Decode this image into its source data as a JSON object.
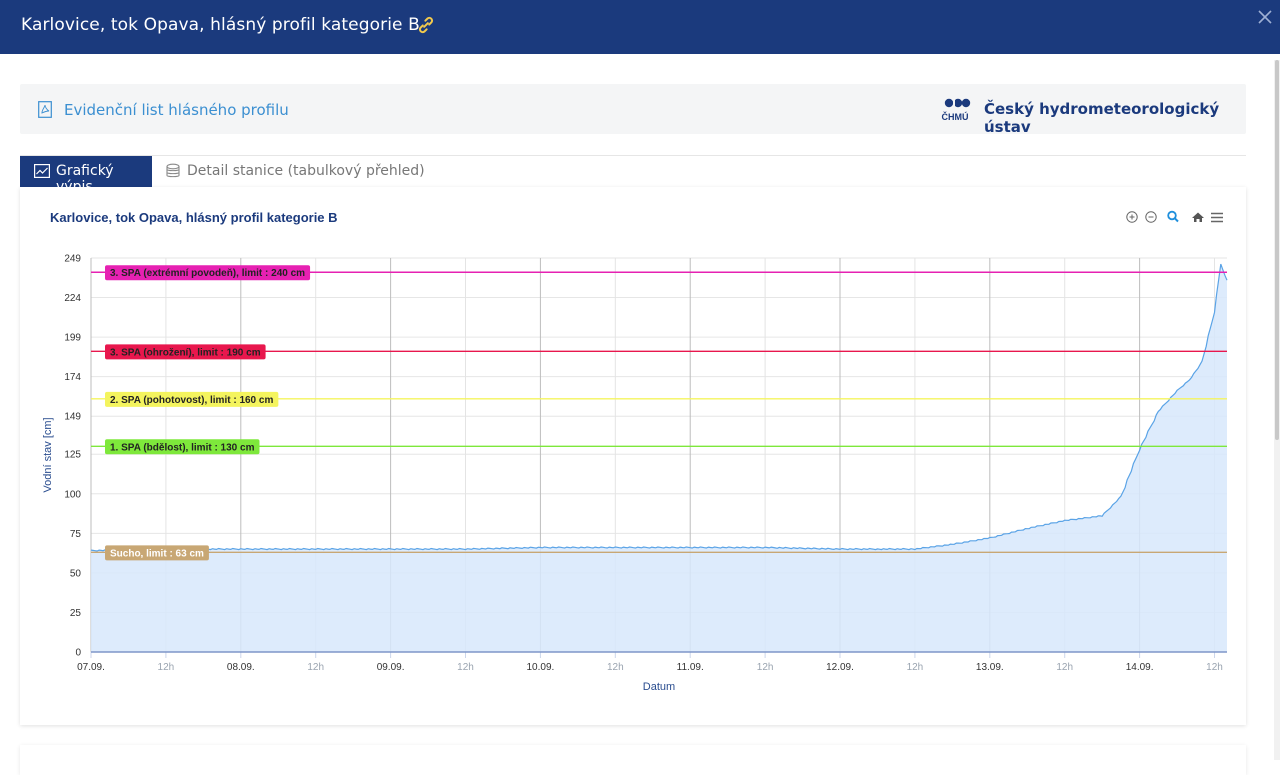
{
  "header": {
    "title": "Karlovice, tok Opava, hlásný profil kategorie B"
  },
  "infobar": {
    "doc_link": "Evidenční list hlásného profilu",
    "logo_text": "ČHMÚ",
    "institute": "Český hydrometeorologický ústav"
  },
  "tabs": [
    {
      "label": "Grafický výpis",
      "active": true
    },
    {
      "label": "Detail stanice (tabulkový přehled)",
      "active": false
    }
  ],
  "colors": {
    "header_bg": "#1b3a7d",
    "link": "#3b8fd1",
    "series_line": "#5aa3e6",
    "series_fill": "#d7e8fb"
  },
  "chart_data": {
    "type": "area",
    "title": "Karlovice, tok Opava, hlásný profil kategorie B",
    "xlabel": "Datum",
    "ylabel": "Vodní stav [cm]",
    "ylim": [
      0,
      249
    ],
    "yticks": [
      0,
      25,
      50,
      75,
      100,
      125,
      149,
      174,
      199,
      224,
      249
    ],
    "xlim": [
      "07.09. 00:00",
      "14.09. 14:00"
    ],
    "xticks": [
      {
        "label": "07.09.",
        "major": true
      },
      {
        "label": "12h",
        "major": false
      },
      {
        "label": "08.09.",
        "major": true
      },
      {
        "label": "12h",
        "major": false
      },
      {
        "label": "09.09.",
        "major": true
      },
      {
        "label": "12h",
        "major": false
      },
      {
        "label": "10.09.",
        "major": true
      },
      {
        "label": "12h",
        "major": false
      },
      {
        "label": "11.09.",
        "major": true
      },
      {
        "label": "12h",
        "major": false
      },
      {
        "label": "12.09.",
        "major": true
      },
      {
        "label": "12h",
        "major": false
      },
      {
        "label": "13.09.",
        "major": true
      },
      {
        "label": "12h",
        "major": false
      },
      {
        "label": "14.09.",
        "major": true
      },
      {
        "label": "12h",
        "major": false
      }
    ],
    "grid": true,
    "series": [
      {
        "x": [
          "07.09. 00:00",
          "07.09. 12:00",
          "08.09. 00:00",
          "08.09. 12:00",
          "09.09. 00:00",
          "09.09. 12:00",
          "10.09. 00:00",
          "10.09. 12:00",
          "11.09. 00:00",
          "11.09. 12:00",
          "12.09. 00:00",
          "12.09. 06:00",
          "12.09. 12:00",
          "12.09. 18:00",
          "13.09. 00:00",
          "13.09. 06:00",
          "13.09. 12:00",
          "13.09. 18:00",
          "13.09. 21:00",
          "14.09. 00:00",
          "14.09. 03:00",
          "14.09. 06:00",
          "14.09. 08:00",
          "14.09. 10:00",
          "14.09. 12:00",
          "14.09. 13:00",
          "14.09. 14:00"
        ],
        "y": [
          64,
          65,
          65,
          65,
          65,
          65,
          66,
          66,
          66,
          66,
          65,
          65,
          65,
          68,
          72,
          78,
          83,
          86,
          98,
          128,
          152,
          165,
          172,
          183,
          215,
          245,
          235
        ]
      }
    ],
    "thresholds": [
      {
        "label": "3. SPA (extrémní povodeň), limit : 240 cm",
        "value": 240,
        "color": "#e621b2"
      },
      {
        "label": "3. SPA (ohrožení), limit : 190 cm",
        "value": 190,
        "color": "#e8174d"
      },
      {
        "label": "2. SPA (pohotovost), limit : 160 cm",
        "value": 160,
        "color": "#f4f45e"
      },
      {
        "label": "1. SPA (bdělost), limit : 130 cm",
        "value": 130,
        "color": "#7ee83b"
      },
      {
        "label": "Sucho, limit : 63 cm",
        "value": 63,
        "color": "#c8a774"
      }
    ]
  }
}
